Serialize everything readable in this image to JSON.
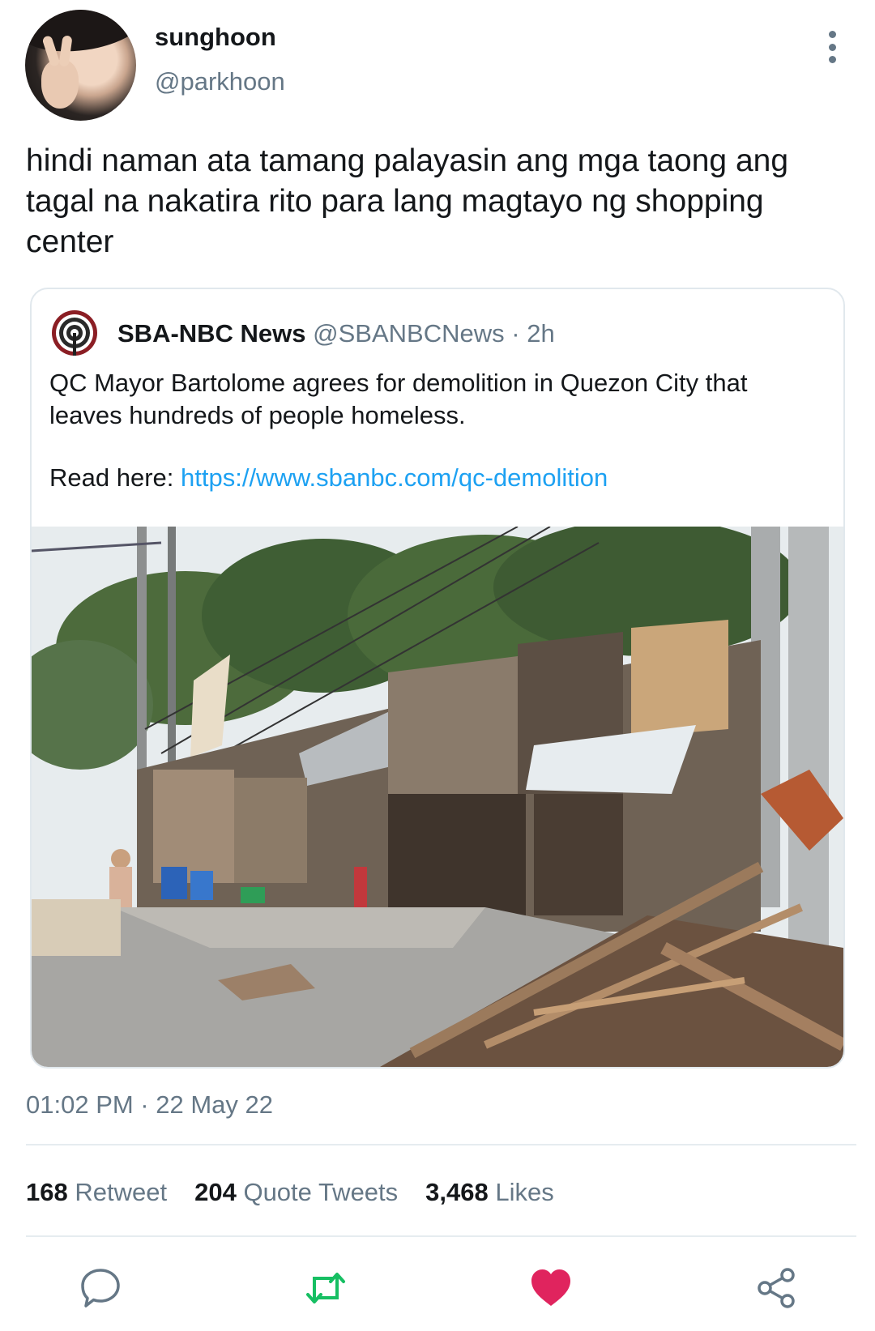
{
  "user": {
    "display_name": "sunghoon",
    "handle": "@parkhoon"
  },
  "tweet_text": "hindi naman ata tamang palayasin ang mga taong ang tagal na nakatira rito para lang magtayo ng shopping center",
  "quoted": {
    "name": "SBA-NBC News",
    "handle": "@SBANBCNews",
    "separator": "·",
    "age": "2h",
    "text": "QC Mayor Bartolome agrees for demolition in Quezon City that leaves hundreds of people homeless.",
    "read_label": "Read here:",
    "link": "https://www.sbanbc.com/qc-demolition"
  },
  "timestamp": "01:02 PM · 22 May 22",
  "stats": {
    "retweets": {
      "count": "168",
      "label": "Retweet"
    },
    "quotes": {
      "count": "204",
      "label": "Quote Tweets"
    },
    "likes": {
      "count": "3,468",
      "label": "Likes"
    }
  },
  "colors": {
    "accent": "#1da1f2",
    "like": "#e0245e",
    "retweet": "#17bf63",
    "secondary_text": "#657786"
  },
  "icons": {
    "reply": "reply-icon",
    "retweet": "retweet-icon",
    "like": "heart-icon",
    "share": "share-icon",
    "more": "more-vertical-icon"
  }
}
